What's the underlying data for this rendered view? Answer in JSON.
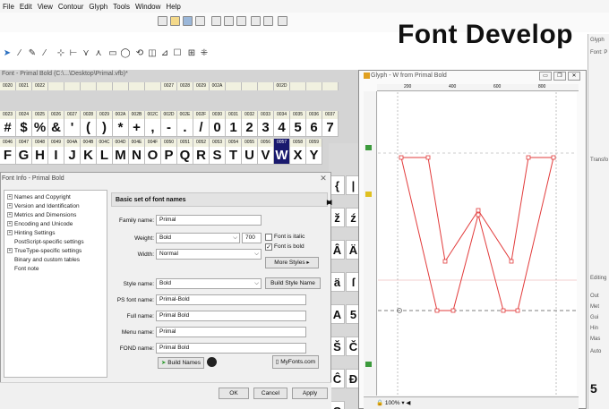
{
  "menu": [
    "File",
    "Edit",
    "View",
    "Contour",
    "Glyph",
    "Tools",
    "Window",
    "Help"
  ],
  "overlay_title": "Font Develop",
  "font_window": {
    "title": "Font - Primal Bold (C:\\...\\Desktop\\Primal.vfb)*",
    "row1_codes": [
      "0020",
      "0021",
      "0022",
      "",
      "",
      "",
      "",
      "",
      "",
      "",
      "0027",
      "0028",
      "0029",
      "002A",
      "",
      "",
      "",
      "002D",
      "",
      "",
      ""
    ],
    "row2_codes": [
      "0023",
      "0024",
      "0025",
      "0026",
      "0027",
      "0028",
      "0029",
      "002A",
      "002B",
      "002C",
      "002D",
      "002E",
      "002F",
      "0030",
      "0031",
      "0032",
      "0033",
      "0034",
      "0035",
      "0036",
      "0037"
    ],
    "row2_glyphs": [
      "#",
      "$",
      "%",
      "&",
      "'",
      "(",
      ")",
      "*",
      "+",
      ",",
      "-",
      ".",
      "/",
      "0",
      "1",
      "2",
      "3",
      "4",
      "5",
      "6",
      "7"
    ],
    "row3_codes": [
      "0046",
      "0047",
      "0048",
      "0049",
      "004A",
      "004B",
      "004C",
      "004D",
      "004E",
      "004F",
      "0050",
      "0051",
      "0052",
      "0053",
      "0054",
      "0055",
      "0056",
      "0057",
      "0058",
      "0059"
    ],
    "row3_glyphs": [
      "F",
      "G",
      "H",
      "I",
      "J",
      "K",
      "L",
      "M",
      "N",
      "O",
      "P",
      "Q",
      "R",
      "S",
      "T",
      "U",
      "V",
      "W",
      "X",
      "Y"
    ],
    "selected_glyph": "W",
    "side_glyphs": [
      "{",
      "|",
      "ž",
      "ź",
      "Â",
      "Ä",
      "ä",
      "ſ",
      "A",
      "5",
      "Š",
      "Č",
      "Ĉ",
      "Đ",
      "Q"
    ]
  },
  "dialog": {
    "title": "Font Info - Primal Bold",
    "tree": [
      {
        "label": "Names and Copyright",
        "expandable": true
      },
      {
        "label": "Version and Identification",
        "expandable": true
      },
      {
        "label": "Metrics and Dimensions",
        "expandable": true
      },
      {
        "label": "Encoding and Unicode",
        "expandable": true
      },
      {
        "label": "Hinting Settings",
        "expandable": true
      },
      {
        "label": "PostScript-specific settings",
        "expandable": false
      },
      {
        "label": "TrueType-specific settings",
        "expandable": true
      },
      {
        "label": "Binary and custom tables",
        "expandable": false
      },
      {
        "label": "Font note",
        "expandable": false
      }
    ],
    "section_title": "Basic set of font names",
    "family_name_label": "Family name:",
    "family_name": "Primal",
    "weight_label": "Weight:",
    "weight": "Bold",
    "weight_value": "700",
    "italic_label": "Font is italic",
    "italic_checked": false,
    "bold_label": "Font is bold",
    "bold_checked": true,
    "width_label": "Width:",
    "width": "Normal",
    "more_styles": "More Styles",
    "style_name_label": "Style name:",
    "style_name": "Bold",
    "build_style_name": "Build Style Name",
    "ps_name_label": "PS font name:",
    "ps_name": "Primal-Bold",
    "full_name_label": "Full name:",
    "full_name": "Primal Bold",
    "menu_name_label": "Menu name:",
    "menu_name": "Primal",
    "fond_name_label": "FOND name:",
    "fond_name": "Primal Bold",
    "build_names": "Build Names",
    "myfonts": "MyFonts.com",
    "ok": "OK",
    "cancel": "Cancel",
    "apply": "Apply"
  },
  "glyph_window": {
    "title": "Glyph - W from Primal Bold",
    "zoom": "100%",
    "ruler_labels": [
      "200",
      "400",
      "600",
      "800"
    ],
    "accent": "#e23b3b"
  },
  "right_panel": {
    "labels": [
      "Glyph",
      "Font: P",
      "Transfo",
      "Editing",
      "Out",
      "Met",
      "Gui",
      "Hin",
      "Mas",
      "Auto"
    ],
    "bottom_value": "5"
  }
}
